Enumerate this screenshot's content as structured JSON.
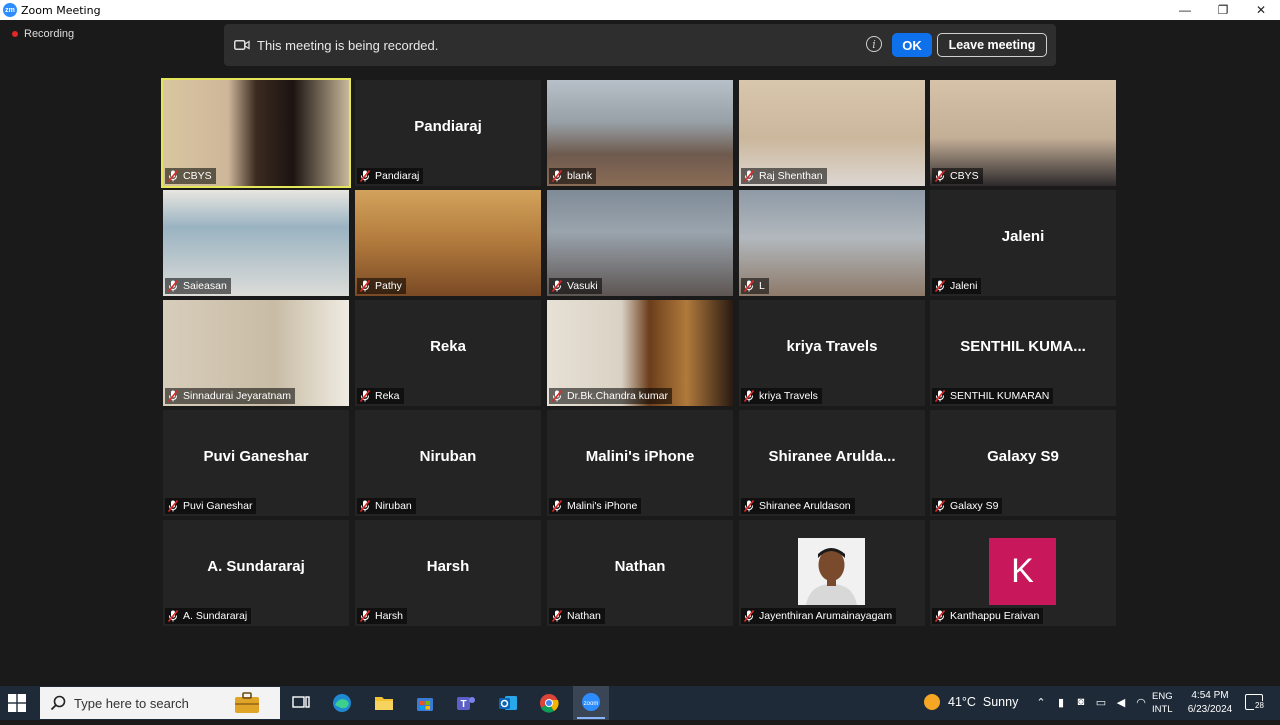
{
  "window": {
    "title": "Zoom Meeting",
    "logo_text": "zm",
    "controls": {
      "minimize": "—",
      "restore": "❐",
      "close": "✕"
    }
  },
  "recording": {
    "label": "Recording"
  },
  "banner": {
    "text": "This meeting is being recorded.",
    "info_symbol": "i",
    "ok_label": "OK",
    "leave_label": "Leave meeting"
  },
  "participants": [
    {
      "label": "CBYS",
      "video": "cbys1",
      "active": true
    },
    {
      "label": "Pandiaraj",
      "display_name": "Pandiaraj"
    },
    {
      "label": "blank",
      "video": "blank"
    },
    {
      "label": "Raj Shenthan",
      "video": "raj"
    },
    {
      "label": "CBYS",
      "video": "cbys2"
    },
    {
      "label": "Saieasan",
      "video": "saieasan"
    },
    {
      "label": "Pathy",
      "video": "pathy"
    },
    {
      "label": "Vasuki",
      "video": "vasuki"
    },
    {
      "label": "L",
      "video": "l"
    },
    {
      "label": "Jaleni",
      "display_name": "Jaleni"
    },
    {
      "label": "Sinnadurai Jeyaratnam",
      "video": "sinna"
    },
    {
      "label": "Reka",
      "display_name": "Reka"
    },
    {
      "label": "Dr.Bk.Chandra kumar",
      "video": "chandra"
    },
    {
      "label": "kriya Travels",
      "display_name": "kriya Travels"
    },
    {
      "label": "SENTHIL KUMARAN",
      "display_name": "SENTHIL KUMA..."
    },
    {
      "label": "Puvi Ganeshar",
      "display_name": "Puvi Ganeshar"
    },
    {
      "label": "Niruban",
      "display_name": "Niruban"
    },
    {
      "label": "Malini's iPhone",
      "display_name": "Malini's iPhone"
    },
    {
      "label": "Shiranee Aruldason",
      "display_name": "Shiranee  Arulda..."
    },
    {
      "label": "Galaxy S9",
      "display_name": "Galaxy S9"
    },
    {
      "label": "A. Sundararaj",
      "display_name": "A. Sundararaj"
    },
    {
      "label": "Harsh",
      "display_name": "Harsh"
    },
    {
      "label": "Nathan",
      "display_name": "Nathan"
    },
    {
      "label": "Jayenthiran Arumainayagam",
      "avatar": "photo"
    },
    {
      "label": "Kanthappu Eraivan",
      "avatar": "letter",
      "avatar_letter": "K"
    }
  ],
  "taskbar": {
    "search_placeholder": "Type here to search",
    "weather": {
      "temp": "41°C",
      "condition": "Sunny"
    },
    "language": {
      "line1": "ENG",
      "line2": "INTL"
    },
    "clock": {
      "time": "4:54 PM",
      "date": "6/23/2024"
    },
    "notification_count": "28",
    "apps": [
      "file-explorer-briefcase",
      "task-view",
      "edge",
      "file-explorer",
      "microsoft-store",
      "teams",
      "outlook",
      "chrome",
      "zoom"
    ]
  },
  "colors": {
    "accent": "#0e71eb",
    "active_speaker": "#e6e65a",
    "recording_dot": "#e02828",
    "avatar_k": "#c9175b"
  }
}
